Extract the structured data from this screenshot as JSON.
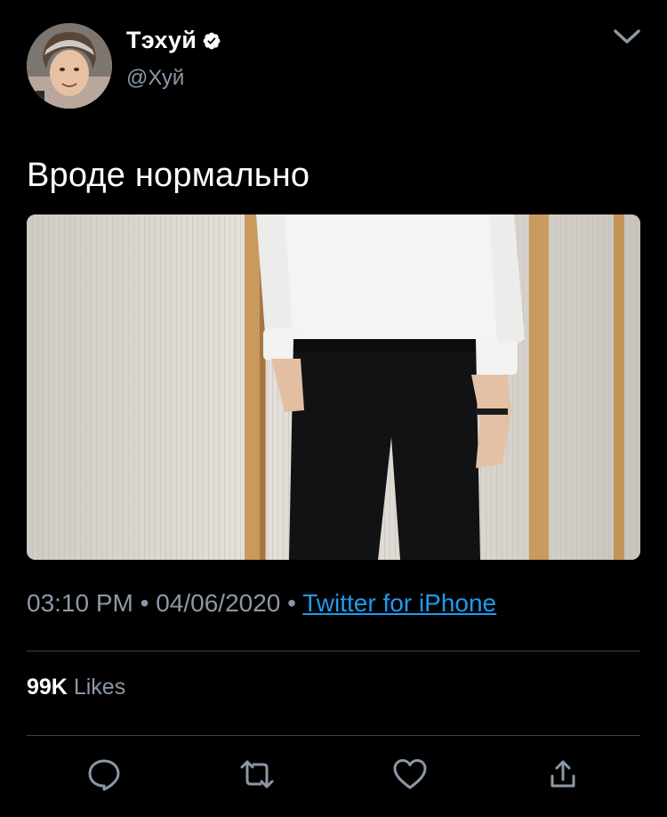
{
  "user": {
    "display_name": "Тэхуй",
    "handle": "@Хуй",
    "verified": true
  },
  "tweet": {
    "text": "Вроде нормально",
    "time": "03:10 PM",
    "separator": "•",
    "date": "04/06/2020",
    "source": "Twitter for iPhone"
  },
  "stats": {
    "likes_count": "99K",
    "likes_label": "Likes"
  },
  "icons": {
    "menu": "chevron-down-icon",
    "verified": "verified-badge-icon",
    "reply": "reply-icon",
    "retweet": "retweet-icon",
    "like": "heart-icon",
    "share": "share-icon"
  },
  "colors": {
    "background": "#000000",
    "text": "#ffffff",
    "secondary": "#8b98a5",
    "link": "#1d9bf0",
    "divider": "#38444d"
  }
}
